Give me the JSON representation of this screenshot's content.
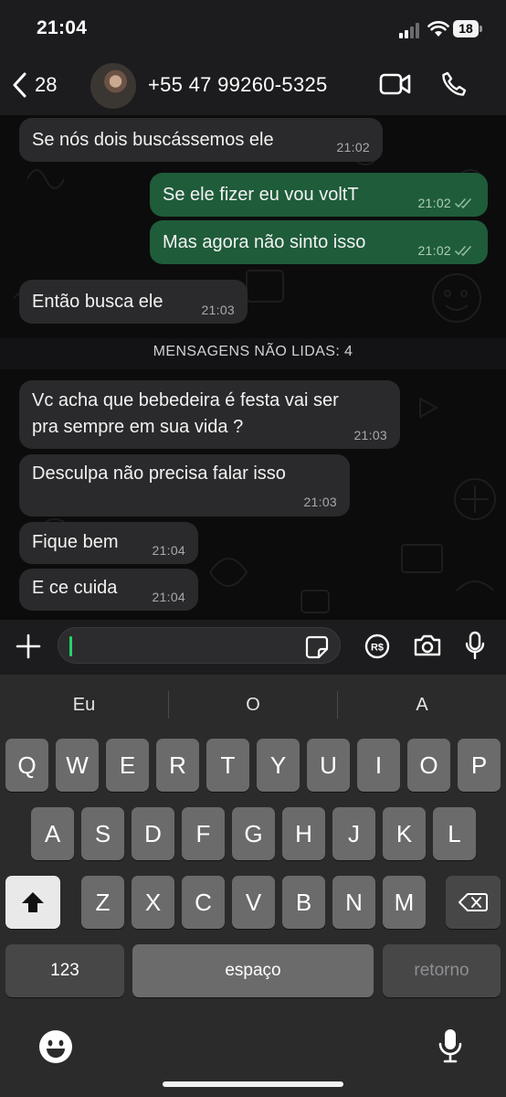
{
  "status_bar": {
    "time": "21:04",
    "battery": "18"
  },
  "header": {
    "back_count": "28",
    "contact_name": "+55 47 99260-5325"
  },
  "chat": {
    "messages": [
      {
        "direction": "in",
        "text": "Se nós dois buscássemos ele",
        "time": "21:02"
      },
      {
        "direction": "out",
        "text": "Se ele fizer eu vou voltT",
        "time": "21:02",
        "status": "read"
      },
      {
        "direction": "out",
        "text": "Mas agora não sinto isso",
        "time": "21:02",
        "status": "read"
      },
      {
        "direction": "in",
        "text": "Então busca ele",
        "time": "21:03"
      },
      {
        "direction": "in",
        "lines": [
          "Vc acha que bebedeira é festa vai ser",
          "pra sempre em sua vida ?"
        ],
        "time": "21:03"
      },
      {
        "direction": "in",
        "text": "Desculpa não precisa falar isso",
        "time": "21:03"
      },
      {
        "direction": "in",
        "text": "Fique bem",
        "time": "21:04"
      },
      {
        "direction": "in",
        "text": "E ce cuida",
        "time": "21:04"
      }
    ],
    "unread_divider": "MENSAGENS NÃO LIDAS: 4"
  },
  "input": {
    "value": ""
  },
  "keyboard": {
    "suggestions": [
      "Eu",
      "O",
      "A"
    ],
    "row1": [
      "Q",
      "W",
      "E",
      "R",
      "T",
      "Y",
      "U",
      "I",
      "O",
      "P"
    ],
    "row2": [
      "A",
      "S",
      "D",
      "F",
      "G",
      "H",
      "J",
      "K",
      "L"
    ],
    "row3": [
      "Z",
      "X",
      "C",
      "V",
      "B",
      "N",
      "M"
    ],
    "numbers_key": "123",
    "space_key": "espaço",
    "return_key": "retorno"
  },
  "colors": {
    "incoming_bubble": "#2a2a2c",
    "outgoing_bubble": "#1f5c3a",
    "accent": "#25d366"
  }
}
